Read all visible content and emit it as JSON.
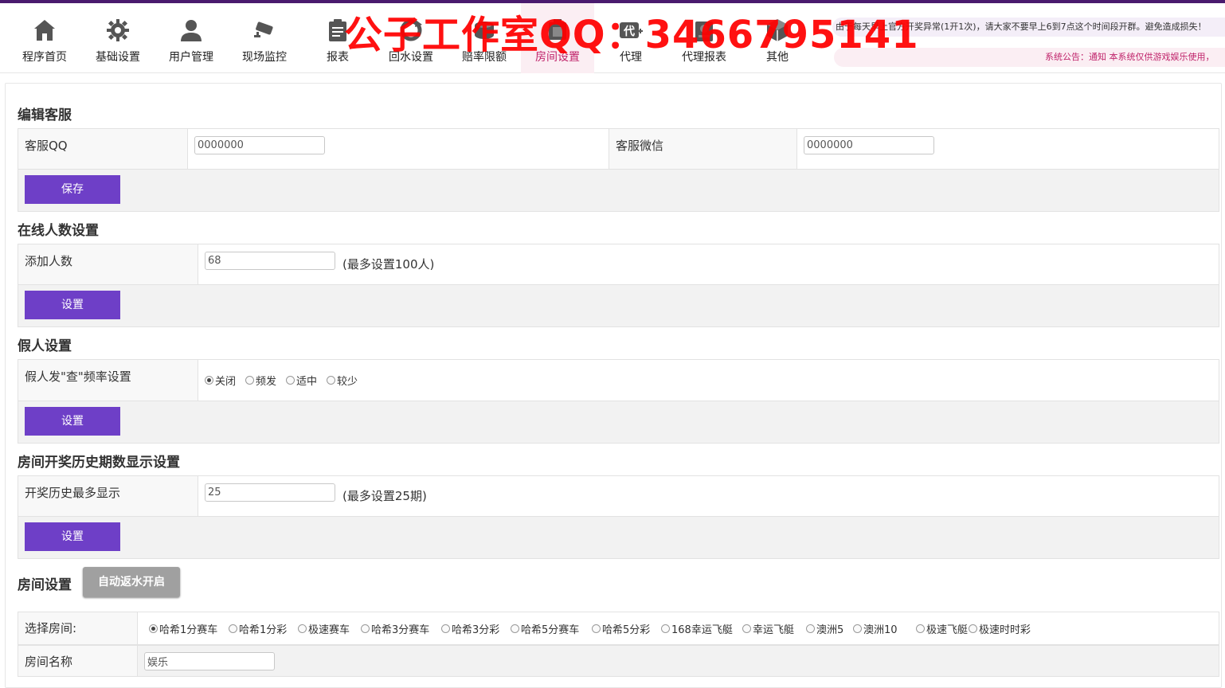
{
  "nav": {
    "items": [
      {
        "label": "程序首页",
        "icon": "home-icon"
      },
      {
        "label": "基础设置",
        "icon": "gear-icon"
      },
      {
        "label": "用户管理",
        "icon": "user-icon"
      },
      {
        "label": "现场监控",
        "icon": "camera-icon"
      },
      {
        "label": "报表",
        "icon": "clipboard-icon"
      },
      {
        "label": "回水设置",
        "icon": "refresh-icon"
      },
      {
        "label": "赔率限额",
        "icon": "coins-icon"
      },
      {
        "label": "房间设置",
        "icon": "room-icon"
      },
      {
        "label": "代理",
        "icon": "agent-icon",
        "icon_text": "代"
      },
      {
        "label": "代理报表",
        "icon": "agent-report-icon"
      },
      {
        "label": "其他",
        "icon": "cube-icon"
      }
    ],
    "active": "房间设置"
  },
  "marquee": {
    "notice1": "由于每天早上官方开奖异常(1开1次)，请大家不要早上6到7点这个时间段开群。避免造成损失！",
    "notice2": "系统公告：通知 本系统仅供游戏娱乐使用，"
  },
  "watermark": "公子工作室QQ：3466795141",
  "sections": {
    "customer_service": {
      "title": "编辑客服",
      "qq_label": "客服QQ",
      "qq_value": "0000000",
      "wechat_label": "客服微信",
      "wechat_value": "0000000",
      "button": "保存"
    },
    "online": {
      "title": "在线人数设置",
      "label": "添加人数",
      "value": "68",
      "hint": "(最多设置100人)",
      "button": "设置"
    },
    "fake": {
      "title": "假人设置",
      "label": "假人发\"查\"频率设置",
      "options": [
        "关闭",
        "频发",
        "适中",
        "较少"
      ],
      "selected": "关闭",
      "button": "设置"
    },
    "history": {
      "title": "房间开奖历史期数显示设置",
      "label": "开奖历史最多显示",
      "value": "25",
      "hint": "(最多设置25期)",
      "button": "设置"
    },
    "room": {
      "title": "房间设置",
      "auto_button": "自动返水开启",
      "select_label": "选择房间:",
      "rooms": [
        "哈希1分赛车",
        "哈希1分彩",
        "极速赛车",
        "哈希3分赛车",
        "哈希3分彩",
        "哈希5分赛车",
        "哈希5分彩",
        "168幸运飞艇",
        "幸运飞艇",
        "澳洲5",
        "澳洲10",
        "极速飞艇",
        "极速时时彩"
      ],
      "selected": "哈希1分赛车",
      "name_label": "房间名称",
      "name_value": "娱乐"
    }
  },
  "colors": {
    "accent": "#6e3fc7",
    "active_tab": "#c0246b",
    "watermark": "#ff0000"
  }
}
